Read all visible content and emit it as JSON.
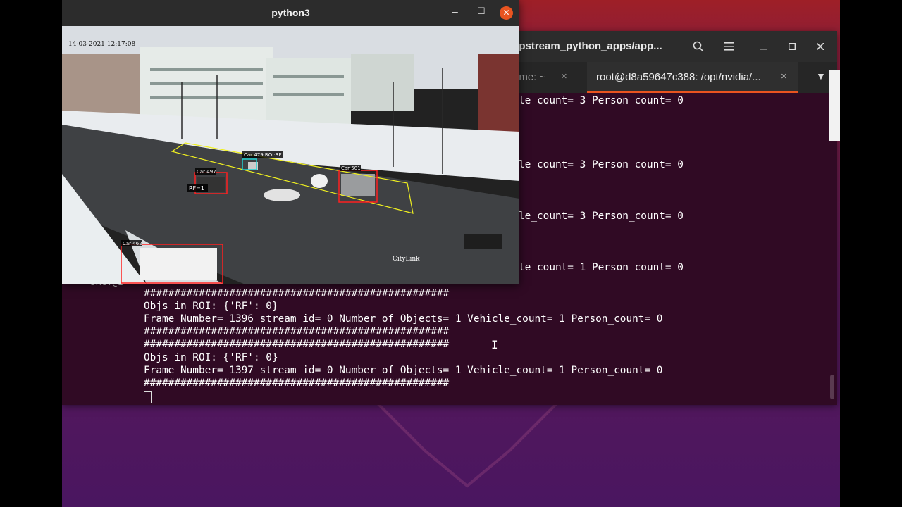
{
  "terminal": {
    "title": "epstream_python_apps/app...",
    "tabs": [
      {
        "label": "ame: ~",
        "active": false
      },
      {
        "label": "root@d8a59647c388: /opt/nvidia/...",
        "active": true
      }
    ],
    "lines": [
      "le_count= 3 Person_count= 0",
      "le_count= 3 Person_count= 0",
      "le_count= 3 Person_count= 0",
      "le_count= 1 Person_count= 0",
      "##################################################",
      "Objs in ROI: {'RF': 0}",
      "Frame Number= 1396 stream id= 0 Number of Objects= 1 Vehicle_count= 1 Person_count= 0",
      "##################################################",
      "##################################################",
      "Objs in ROI: {'RF': 0}",
      "Frame Number= 1397 stream id= 0 Number of Objects= 1 Vehicle_count= 1 Person_count= 0",
      "##################################################"
    ],
    "prompt_fragment": "sKCT@z"
  },
  "python_window": {
    "title": "python3"
  },
  "video": {
    "timestamp": "14-03-2021 12:17:08",
    "watermark": "CityLink",
    "detections": [
      {
        "label": "Car 497"
      },
      {
        "label": "Car 479 ROI:RF"
      },
      {
        "label": "Car 501"
      },
      {
        "label": "Car 462"
      }
    ],
    "roi_label": "RF=1"
  },
  "colors": {
    "accent": "#e95420",
    "terminal_bg": "#300a24",
    "bbox": "#ff2020",
    "roi_line": "#f0f020"
  }
}
